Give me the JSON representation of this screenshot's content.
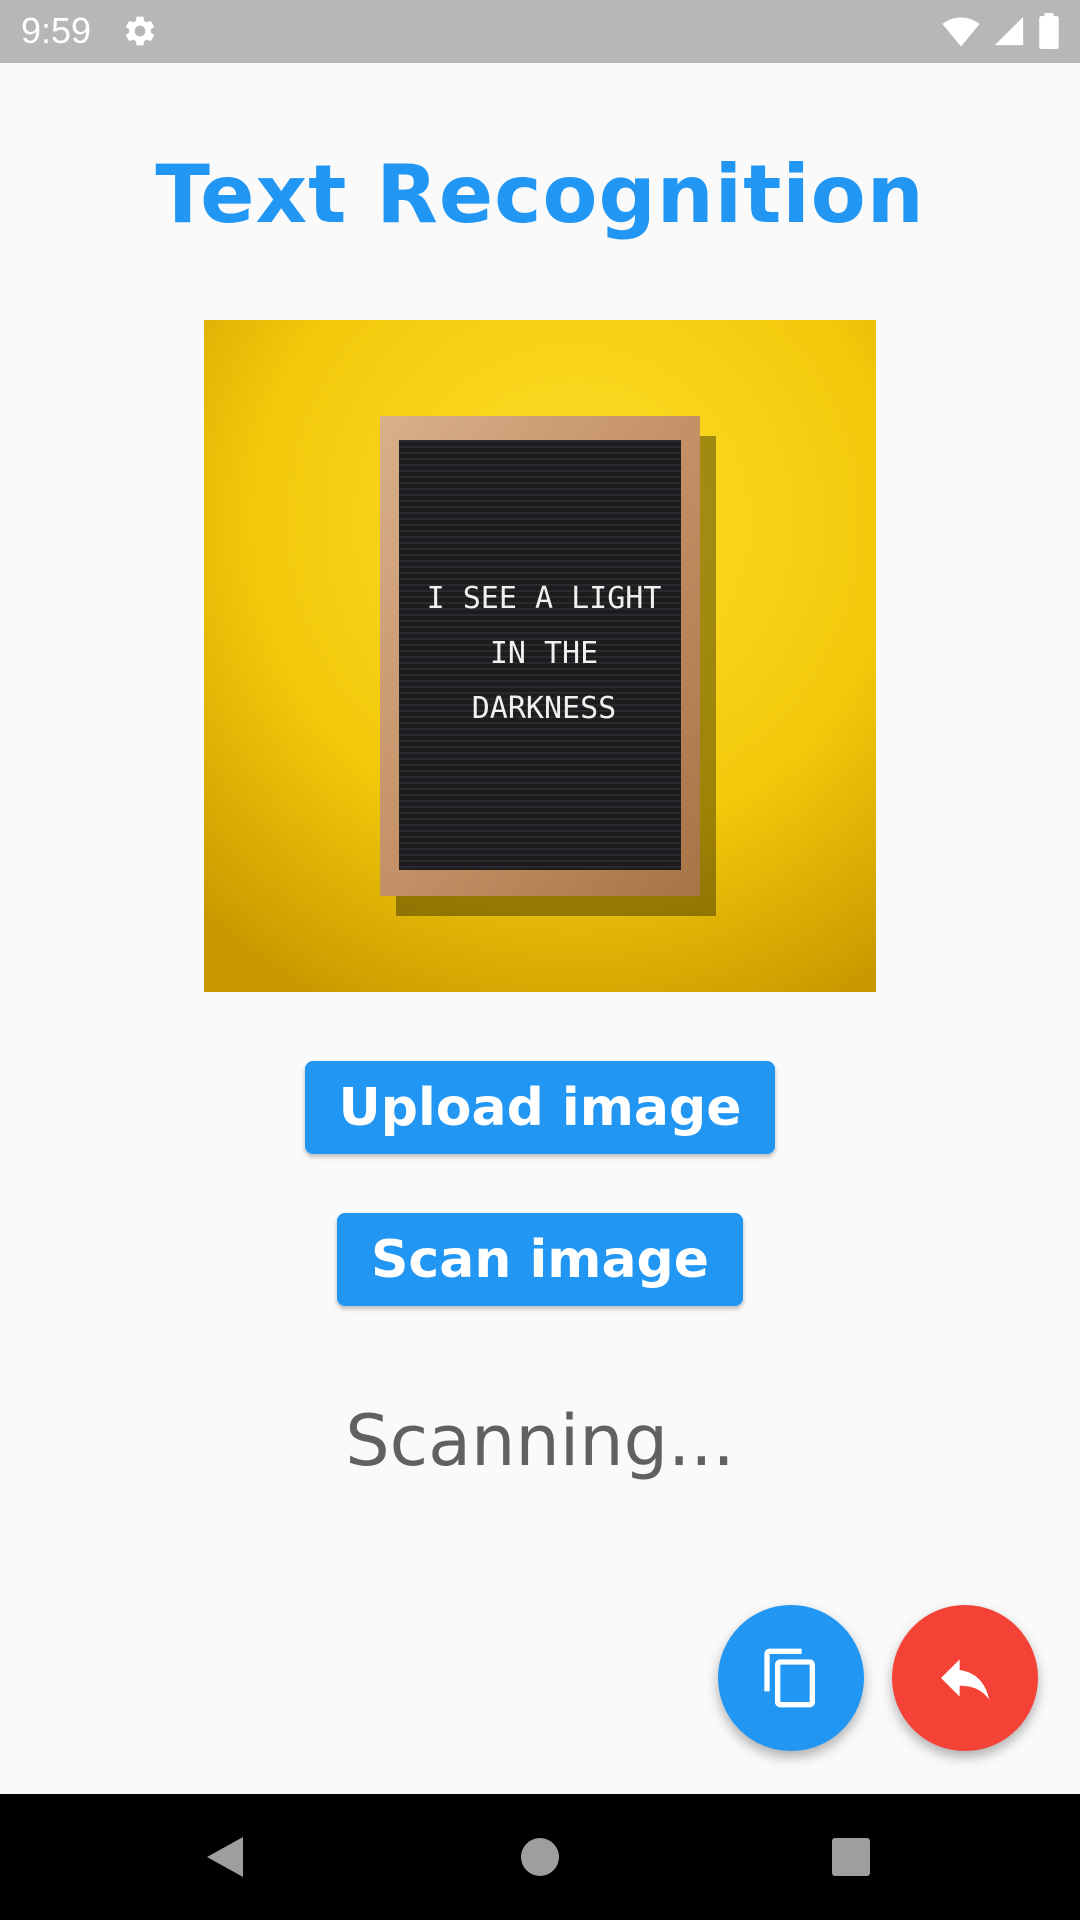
{
  "status_bar": {
    "time": "9:59",
    "icons": [
      "settings-icon",
      "wifi-icon",
      "signal-icon",
      "battery-icon"
    ]
  },
  "app": {
    "title": "Text Recognition",
    "title_color": "#2196f3"
  },
  "preview": {
    "board_lines": [
      "I SEE A LIGHT",
      "IN THE",
      "DARKNESS"
    ]
  },
  "buttons": {
    "upload_label": "Upload image",
    "scan_label": "Scan image",
    "color": "#2196f3"
  },
  "status": {
    "text": "Scanning..."
  },
  "fabs": {
    "copy": {
      "icon": "copy-icon",
      "color": "#2196f3"
    },
    "reply": {
      "icon": "reply-icon",
      "color": "#f44336"
    }
  },
  "nav": {
    "icons": [
      "back-icon",
      "home-icon",
      "recents-icon"
    ]
  }
}
